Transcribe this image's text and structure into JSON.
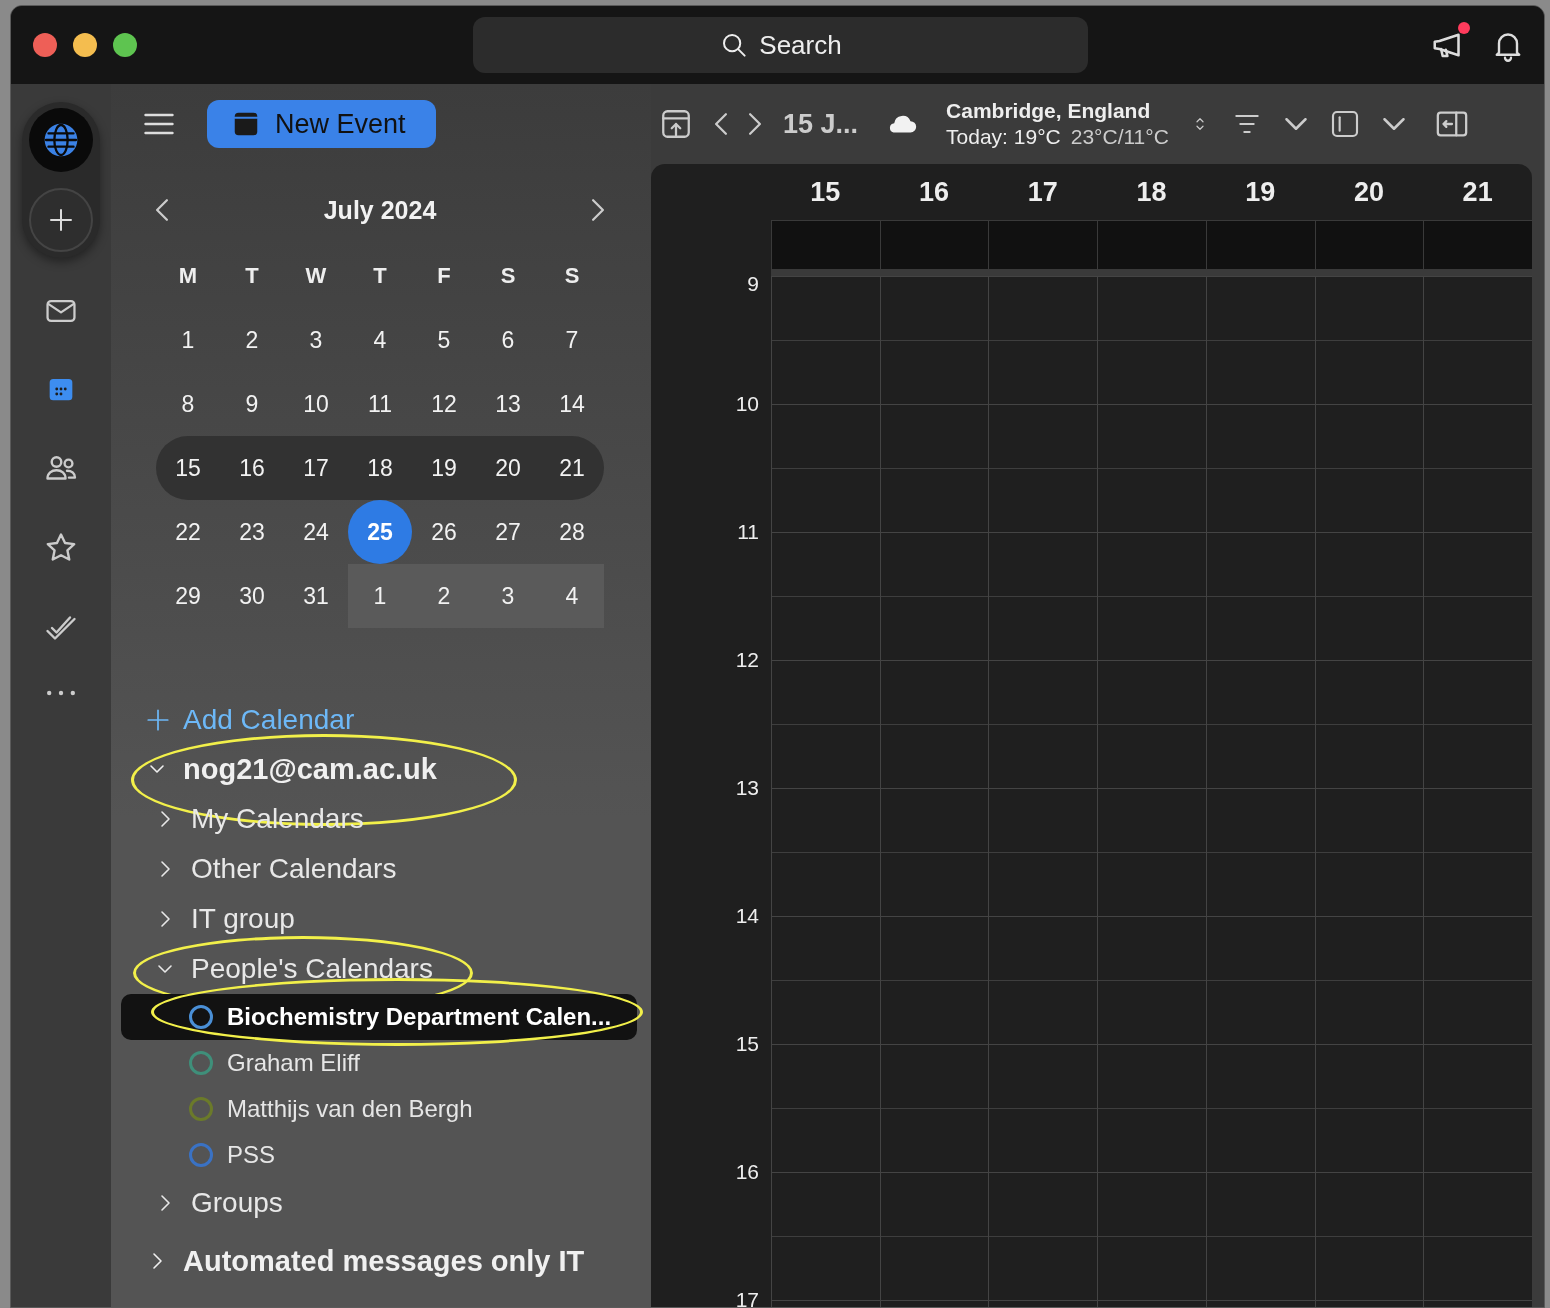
{
  "search": {
    "placeholder": "Search"
  },
  "rail": [
    {
      "kind": "mail",
      "selected": false
    },
    {
      "kind": "calendar",
      "selected": true
    },
    {
      "kind": "people",
      "selected": false
    },
    {
      "kind": "star",
      "selected": false
    },
    {
      "kind": "tasks",
      "selected": false
    },
    {
      "kind": "more",
      "selected": false
    }
  ],
  "new_event": "New Event",
  "mini_calendar": {
    "title": "July 2024",
    "weekdays": [
      "M",
      "T",
      "W",
      "T",
      "F",
      "S",
      "S"
    ],
    "weeks": [
      {
        "selected": false,
        "days": [
          {
            "label": "1",
            "selected": false,
            "other_month": false
          },
          {
            "label": "2",
            "selected": false,
            "other_month": false
          },
          {
            "label": "3",
            "selected": false,
            "other_month": false
          },
          {
            "label": "4",
            "selected": false,
            "other_month": false
          },
          {
            "label": "5",
            "selected": false,
            "other_month": false
          },
          {
            "label": "6",
            "selected": false,
            "other_month": false
          },
          {
            "label": "7",
            "selected": false,
            "other_month": false
          }
        ]
      },
      {
        "selected": false,
        "days": [
          {
            "label": "8",
            "selected": false,
            "other_month": false
          },
          {
            "label": "9",
            "selected": false,
            "other_month": false
          },
          {
            "label": "10",
            "selected": false,
            "other_month": false
          },
          {
            "label": "11",
            "selected": false,
            "other_month": false
          },
          {
            "label": "12",
            "selected": false,
            "other_month": false
          },
          {
            "label": "13",
            "selected": false,
            "other_month": false
          },
          {
            "label": "14",
            "selected": false,
            "other_month": false
          }
        ]
      },
      {
        "selected": true,
        "days": [
          {
            "label": "15",
            "selected": false,
            "other_month": false
          },
          {
            "label": "16",
            "selected": false,
            "other_month": false
          },
          {
            "label": "17",
            "selected": false,
            "other_month": false
          },
          {
            "label": "18",
            "selected": false,
            "other_month": false
          },
          {
            "label": "19",
            "selected": false,
            "other_month": false
          },
          {
            "label": "20",
            "selected": false,
            "other_month": false
          },
          {
            "label": "21",
            "selected": false,
            "other_month": false
          }
        ]
      },
      {
        "selected": false,
        "days": [
          {
            "label": "22",
            "selected": false,
            "other_month": false
          },
          {
            "label": "23",
            "selected": false,
            "other_month": false
          },
          {
            "label": "24",
            "selected": false,
            "other_month": false
          },
          {
            "label": "25",
            "selected": true,
            "other_month": false
          },
          {
            "label": "26",
            "selected": false,
            "other_month": false
          },
          {
            "label": "27",
            "selected": false,
            "other_month": false
          },
          {
            "label": "28",
            "selected": false,
            "other_month": false
          }
        ]
      },
      {
        "selected": false,
        "days": [
          {
            "label": "29",
            "selected": false,
            "other_month": false
          },
          {
            "label": "30",
            "selected": false,
            "other_month": false
          },
          {
            "label": "31",
            "selected": false,
            "other_month": false
          },
          {
            "label": "1",
            "selected": false,
            "other_month": true
          },
          {
            "label": "2",
            "selected": false,
            "other_month": true
          },
          {
            "label": "3",
            "selected": false,
            "other_month": true
          },
          {
            "label": "4",
            "selected": false,
            "other_month": true
          }
        ]
      }
    ]
  },
  "add_calendar": "Add Calendar",
  "tree": [
    {
      "kind": "account",
      "label": "nog21@cam.ac.uk",
      "expanded": true,
      "highlighted": true,
      "children": [
        {
          "kind": "group",
          "label": "My Calendars",
          "expanded": false,
          "highlighted": false
        },
        {
          "kind": "group",
          "label": "Other Calendars",
          "expanded": false,
          "highlighted": false
        },
        {
          "kind": "group",
          "label": "IT group",
          "expanded": false,
          "highlighted": false
        },
        {
          "kind": "group",
          "label": "People's Calendars",
          "expanded": true,
          "highlighted": true,
          "children": [
            {
              "kind": "calendar",
              "label": "Biochemistry Department Calen...",
              "color": "#4a8fd6",
              "selected": true,
              "highlighted": true
            },
            {
              "kind": "calendar",
              "label": "Graham Eliff",
              "color": "#3f8f7a",
              "selected": false,
              "highlighted": false
            },
            {
              "kind": "calendar",
              "label": "Matthijs van den Bergh",
              "color": "#6b7a2a",
              "selected": false,
              "highlighted": false
            },
            {
              "kind": "calendar",
              "label": "PSS",
              "color": "#3a72c4",
              "selected": false,
              "highlighted": false
            }
          ]
        },
        {
          "kind": "group",
          "label": "Groups",
          "expanded": false,
          "highlighted": false
        }
      ]
    },
    {
      "kind": "account",
      "label": "Automated messages only IT",
      "expanded": false,
      "highlighted": false
    }
  ],
  "toolbar": {
    "date_label": "15 J...",
    "weather": {
      "location": "Cambridge, England",
      "today": "Today: 19°C",
      "range": "23°C/11°C"
    }
  },
  "week_view": {
    "days": [
      "15",
      "16",
      "17",
      "18",
      "19",
      "20",
      "21"
    ],
    "hours": [
      "9",
      "10",
      "11",
      "12",
      "13",
      "14",
      "15",
      "16",
      "17"
    ]
  }
}
